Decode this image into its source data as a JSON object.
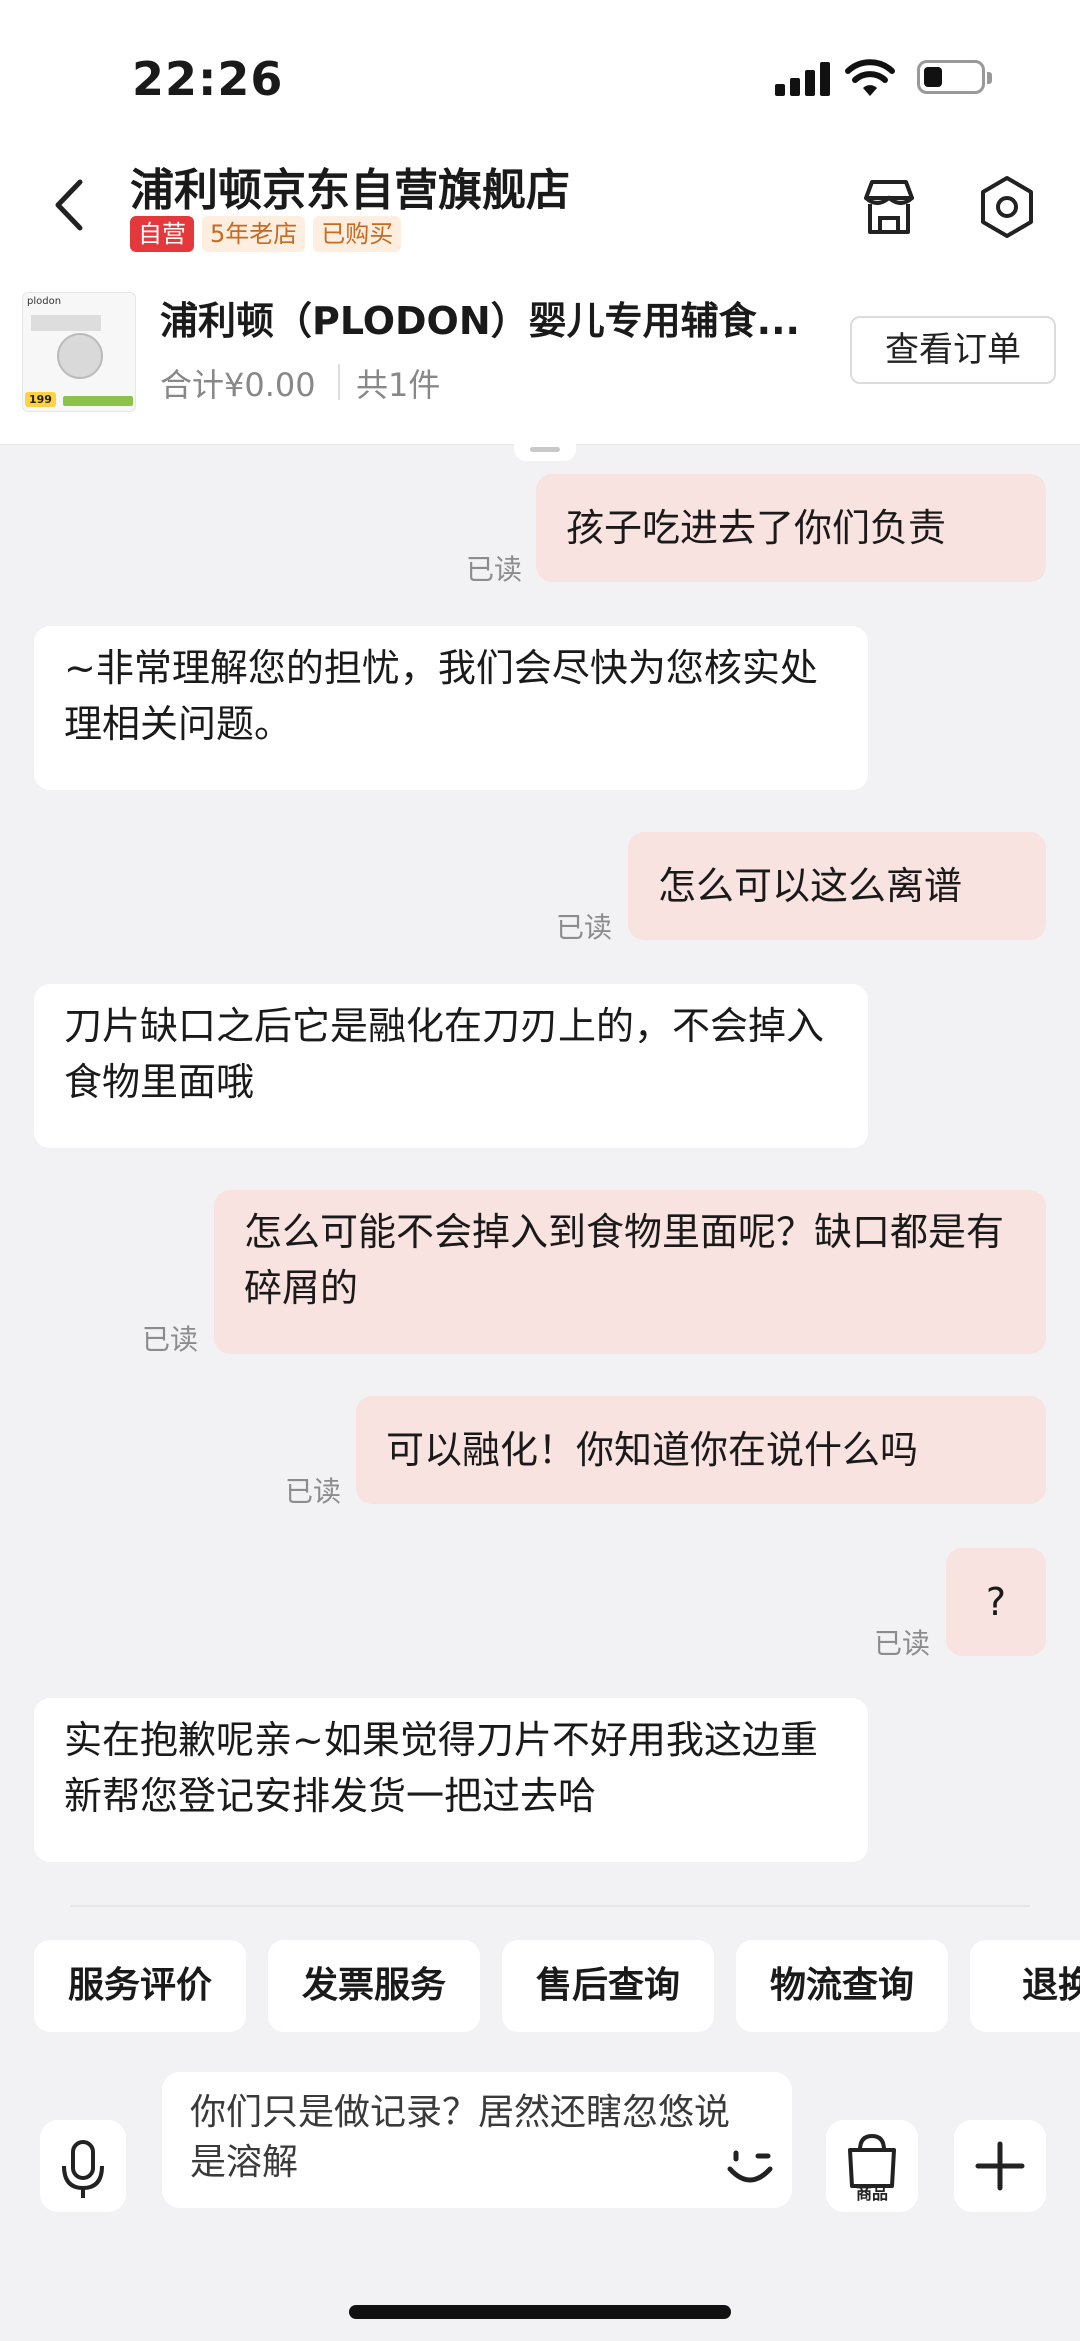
{
  "status_bar": {
    "time": "22:26"
  },
  "header": {
    "shop_name": "浦利顿京东自营旗舰店",
    "badges": {
      "self_operated": "自营",
      "years": "5年老店",
      "purchased": "已购买"
    }
  },
  "product": {
    "thumb_brand": "plodon",
    "thumb_price": "199",
    "title": "浦利顿（PLODON）婴儿专用辅食...",
    "total": "合计¥0.00",
    "count": "共1件",
    "order_button": "查看订单"
  },
  "messages": [
    {
      "side": "out",
      "text": "孩子吃进去了你们负责",
      "read": "已读"
    },
    {
      "side": "in",
      "text": "~非常理解您的担忧，我们会尽快为您核实处理相关问题。"
    },
    {
      "side": "out",
      "text": "怎么可以这么离谱",
      "read": "已读"
    },
    {
      "side": "in",
      "text": "刀片缺口之后它是融化在刀刃上的，不会掉入食物里面哦"
    },
    {
      "side": "out",
      "text": "怎么可能不会掉入到食物里面呢？缺口都是有碎屑的",
      "read": "已读"
    },
    {
      "side": "out",
      "text": "可以融化！你知道你在说什么吗",
      "read": "已读"
    },
    {
      "side": "out",
      "text": "?",
      "read": "已读"
    },
    {
      "side": "in",
      "text": "实在抱歉呢亲~如果觉得刀片不好用我这边重新帮您登记安排发货一把过去哈"
    }
  ],
  "quick_actions": [
    "服务评价",
    "发票服务",
    "售后查询",
    "物流查询",
    "退换货"
  ],
  "input": {
    "value": "你们只是做记录？居然还瞎忽悠说是溶解",
    "goods_label": "商品"
  },
  "icons": {
    "back": "chevron-left-icon",
    "store": "store-icon",
    "settings": "settings-icon",
    "voice": "microphone-icon",
    "emoji": "emoji-icon",
    "goods": "shopping-bag-icon",
    "plus": "plus-icon"
  },
  "colors": {
    "self_badge": "#e4393c",
    "outgoing_bubble": "#f9e3e1",
    "incoming_bubble": "#ffffff",
    "background": "#f2f2f4"
  }
}
